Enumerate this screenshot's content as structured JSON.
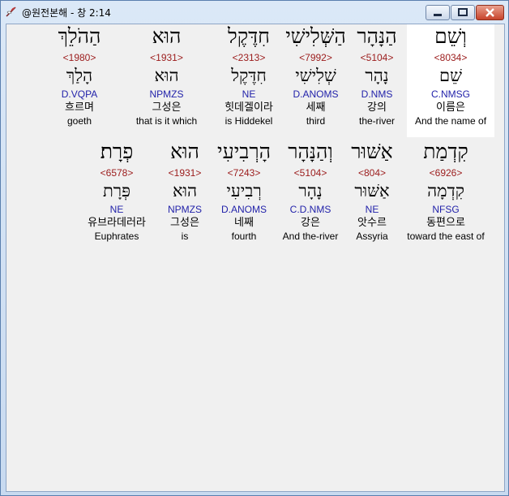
{
  "window": {
    "title": "@원전본해 - 창 2:14",
    "app_icon": "dove-quill-icon",
    "controls": [
      "minimize",
      "maximize",
      "close"
    ]
  },
  "selected_word_index": 0,
  "rows": [
    {
      "words": [
        {
          "hebrew": "וְשֵׁם",
          "strong": "<8034>",
          "lemma": "שֵׁם",
          "morph": "C.NMSG",
          "korean": "이름은",
          "english": "And the name of"
        },
        {
          "hebrew": "הַנָּהָר",
          "strong": "<5104>",
          "lemma": "נָהָר",
          "morph": "D.NMS",
          "korean": "강의",
          "english": "the-river"
        },
        {
          "hebrew": "הַשְּׁלִישִׁי",
          "strong": "<7992>",
          "lemma": "שְׁלִישִׁי",
          "morph": "D.ANOMS",
          "korean": "세째",
          "english": "third"
        },
        {
          "hebrew": "חִדֶּקֶל",
          "strong": "<2313>",
          "lemma": "חִדֶּקֶל",
          "morph": "NE",
          "korean": "힛데겔이라",
          "english": "is Hiddekel"
        },
        {
          "hebrew": "הוּא",
          "strong": "<1931>",
          "lemma": "הוּא",
          "morph": "NPMZS",
          "korean": "그성은",
          "english": "that is it which"
        },
        {
          "hebrew": "הַהֹלֵךְ",
          "strong": "<1980>",
          "lemma": "הָלַךְ",
          "morph": "D.VQPA",
          "korean": "흐르며",
          "english": "goeth"
        }
      ]
    },
    {
      "words": [
        {
          "hebrew": "קִדְמַת",
          "strong": "<6926>",
          "lemma": "קִדְמָה",
          "morph": "NFSG",
          "korean": "동편으로",
          "english": "toward the east of"
        },
        {
          "hebrew": "אַשּׁוּר",
          "strong": "<804>",
          "lemma": "אַשּׁוּר",
          "morph": "NE",
          "korean": "앗수르",
          "english": "Assyria"
        },
        {
          "hebrew": "וְהַנָּהָר",
          "strong": "<5104>",
          "lemma": "נָהָר",
          "morph": "C.D.NMS",
          "korean": "강은",
          "english": "And the-river"
        },
        {
          "hebrew": "הָרְבִיעִי",
          "strong": "<7243>",
          "lemma": "רְבִיעִי",
          "morph": "D.ANOMS",
          "korean": "네째",
          "english": "fourth"
        },
        {
          "hebrew": "הוּא",
          "strong": "<1931>",
          "lemma": "הוּא",
          "morph": "NPMZS",
          "korean": "그성은",
          "english": "is"
        },
        {
          "hebrew": "פְרָת׃",
          "strong": "<6578>",
          "lemma": "פְּרָת",
          "morph": "NE",
          "korean": "유브라데러라",
          "english": "Euphrates"
        }
      ]
    }
  ]
}
